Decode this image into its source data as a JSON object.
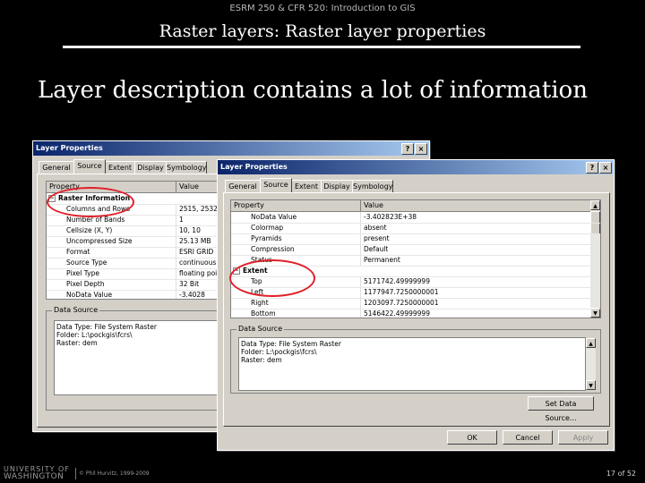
{
  "slide": {
    "course": "ESRM 250 & CFR 520: Introduction to GIS",
    "title": "Raster layers: Raster layer properties",
    "headline": "Layer description contains a lot of information",
    "footer_logo_top": "UNIVERSITY OF",
    "footer_logo_bottom": "WASHINGTON",
    "footer_copyright": "© Phil Hurvitz, 1999-2009",
    "page": "17 of 52"
  },
  "dialog_back": {
    "title": "Layer Properties",
    "help_btn": "?",
    "close_btn": "×",
    "tabs": [
      "General",
      "Source",
      "Extent",
      "Display",
      "Symbology"
    ],
    "active_tab": "Source",
    "grid_headers": [
      "Property",
      "Value"
    ],
    "rows": [
      {
        "p": "Raster Information",
        "v": "",
        "group": true
      },
      {
        "p": "Columns and Rows",
        "v": "2515, 2532"
      },
      {
        "p": "Number of Bands",
        "v": "1"
      },
      {
        "p": "Cellsize (X, Y)",
        "v": "10, 10"
      },
      {
        "p": "Uncompressed Size",
        "v": "25.13 MB"
      },
      {
        "p": "Format",
        "v": "ESRI GRID"
      },
      {
        "p": "Source Type",
        "v": "continuous"
      },
      {
        "p": "Pixel Type",
        "v": "floating point"
      },
      {
        "p": "Pixel Depth",
        "v": "32 Bit"
      },
      {
        "p": "NoData Value",
        "v": "-3.4028"
      }
    ],
    "data_source_label": "Data Source",
    "data_source_text": "Data Type: File System Raster\nFolder: L:\\pockgis\\fcrs\\\nRaster: dem"
  },
  "dialog_front": {
    "title": "Layer Properties",
    "help_btn": "?",
    "close_btn": "×",
    "tabs": [
      "General",
      "Source",
      "Extent",
      "Display",
      "Symbology"
    ],
    "active_tab": "Source",
    "grid_headers": [
      "Property",
      "Value"
    ],
    "rows": [
      {
        "p": "NoData Value",
        "v": "-3.402823E+38"
      },
      {
        "p": "Colormap",
        "v": "absent"
      },
      {
        "p": "Pyramids",
        "v": "present"
      },
      {
        "p": "Compression",
        "v": "Default"
      },
      {
        "p": "Status",
        "v": "Permanent"
      },
      {
        "p": "Extent",
        "v": "",
        "group": true
      },
      {
        "p": "Top",
        "v": "5171742.49999999"
      },
      {
        "p": "Left",
        "v": "1177947.7250000001"
      },
      {
        "p": "Right",
        "v": "1203097.7250000001"
      },
      {
        "p": "Bottom",
        "v": "5146422.49999999"
      }
    ],
    "data_source_label": "Data Source",
    "data_source_text": "Data Type: File System Raster\nFolder: L:\\pockgis\\fcrs\\\nRaster: dem",
    "set_source_btn": "Set Data Source...",
    "ok_btn": "OK",
    "cancel_btn": "Cancel",
    "apply_btn": "Apply"
  },
  "scroll_icons": {
    "up": "▲",
    "down": "▼"
  },
  "colors": {
    "highlight_ring": "#e0202a",
    "titlebar_start": "#0a246a",
    "titlebar_end": "#a6caf0",
    "dialog_face": "#d4d0c8"
  }
}
